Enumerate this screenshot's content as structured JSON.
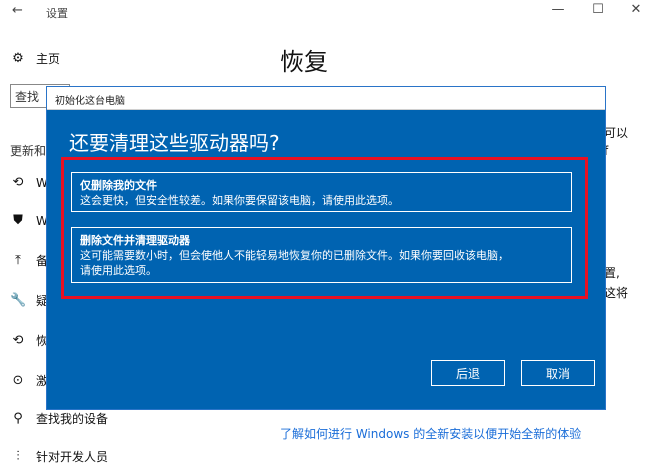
{
  "window": {
    "title": "设置",
    "back_glyph": "←",
    "minimize_glyph": "—",
    "maximize_glyph": "☐",
    "close_glyph": "✕"
  },
  "sidebar": {
    "home_label": "主页",
    "search_partial": "查找",
    "group_partial": "更新和",
    "items": [
      {
        "icon": "refresh-icon",
        "glyph": "⟲",
        "label": "W"
      },
      {
        "icon": "shield-icon",
        "glyph": "⛊",
        "label": "W"
      },
      {
        "icon": "backup-icon",
        "glyph": "⤒",
        "label": "备"
      },
      {
        "icon": "wrench-icon",
        "glyph": "🔧",
        "label": "疑"
      },
      {
        "icon": "recovery-icon",
        "glyph": "⟲",
        "label": "恢"
      },
      {
        "icon": "activation-icon",
        "glyph": "⊙",
        "label": "激"
      },
      {
        "icon": "find-device-icon",
        "glyph": "⚲",
        "label": "查找我的设备"
      },
      {
        "icon": "developer-icon",
        "glyph": "⫶",
        "label": "针对开发人员"
      }
    ]
  },
  "main": {
    "title": "恢复",
    "right_fragments": [
      "可以",
      "f",
      "置,",
      "这将"
    ],
    "bottom_link": "了解如何进行 Windows 的全新安装以便开始全新的体验"
  },
  "dialog": {
    "window_title": "初始化这台电脑",
    "heading": "还要清理这些驱动器吗?",
    "options": [
      {
        "title": "仅删除我的文件",
        "description": "这会更快，但安全性较差。如果你要保留该电脑，请使用此选项。"
      },
      {
        "title": "删除文件并清理驱动器",
        "description_line1": "这可能需要数小时，但会使他人不能轻易地恢复你的已删除文件。如果你要回收该电脑，",
        "description_line2": "请使用此选项。"
      }
    ],
    "back_button": "后退",
    "cancel_button": "取消"
  },
  "colors": {
    "dialog_blue": "#0063b1",
    "highlight_red": "#e81123",
    "link_blue": "#1a6dd8"
  }
}
